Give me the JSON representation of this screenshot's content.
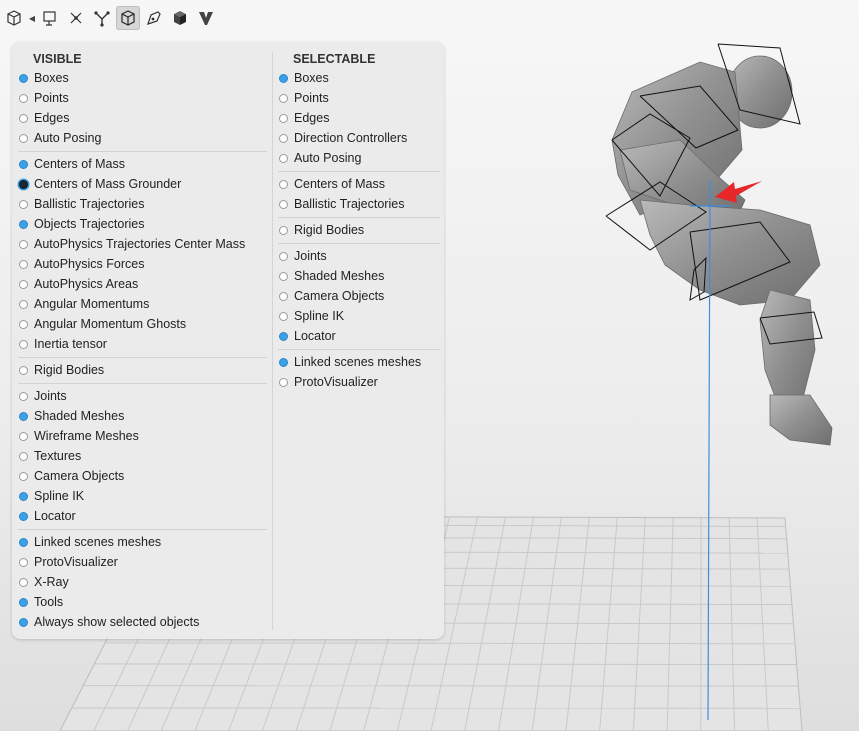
{
  "toolbar": {
    "icons": [
      "cube-outline-icon",
      "triangle-left-icon",
      "frame-icon",
      "joints-graph-icon",
      "bone-icon",
      "box-wireframe-icon",
      "pen-tool-icon",
      "solid-cube-icon",
      "v-shape-icon"
    ]
  },
  "visible": {
    "title": "VISIBLE",
    "groups": [
      [
        {
          "label": "Boxes",
          "state": "on"
        },
        {
          "label": "Points",
          "state": "off"
        },
        {
          "label": "Edges",
          "state": "off"
        },
        {
          "label": "Auto Posing",
          "state": "off"
        }
      ],
      [
        {
          "label": "Centers of Mass",
          "state": "on"
        },
        {
          "label": "Centers of Mass Grounder",
          "state": "dark"
        },
        {
          "label": "Ballistic Trajectories",
          "state": "off"
        },
        {
          "label": "Objects Trajectories",
          "state": "on"
        },
        {
          "label": "AutoPhysics Trajectories Center Mass",
          "state": "off"
        },
        {
          "label": "AutoPhysics Forces",
          "state": "off"
        },
        {
          "label": "AutoPhysics Areas",
          "state": "off"
        },
        {
          "label": "Angular Momentums",
          "state": "off"
        },
        {
          "label": "Angular Momentum Ghosts",
          "state": "off"
        },
        {
          "label": "Inertia tensor",
          "state": "off"
        }
      ],
      [
        {
          "label": "Rigid Bodies",
          "state": "off"
        }
      ],
      [
        {
          "label": "Joints",
          "state": "off"
        },
        {
          "label": "Shaded Meshes",
          "state": "on"
        },
        {
          "label": "Wireframe Meshes",
          "state": "off"
        },
        {
          "label": "Textures",
          "state": "off"
        },
        {
          "label": "Camera Objects",
          "state": "off"
        },
        {
          "label": "Spline IK",
          "state": "on"
        },
        {
          "label": "Locator",
          "state": "on"
        }
      ],
      [
        {
          "label": "Linked scenes meshes",
          "state": "on"
        },
        {
          "label": "ProtoVisualizer",
          "state": "off"
        },
        {
          "label": "X-Ray",
          "state": "off"
        },
        {
          "label": "Tools",
          "state": "on"
        },
        {
          "label": "Always show selected objects",
          "state": "on"
        }
      ]
    ]
  },
  "selectable": {
    "title": "SELECTABLE",
    "groups": [
      [
        {
          "label": "Boxes",
          "state": "on"
        },
        {
          "label": "Points",
          "state": "off"
        },
        {
          "label": "Edges",
          "state": "off"
        },
        {
          "label": "Direction Controllers",
          "state": "off"
        },
        {
          "label": "Auto Posing",
          "state": "off"
        }
      ],
      [
        {
          "label": "Centers of Mass",
          "state": "off"
        },
        {
          "label": "Ballistic Trajectories",
          "state": "off"
        }
      ],
      [
        {
          "label": "Rigid Bodies",
          "state": "off"
        }
      ],
      [
        {
          "label": "Joints",
          "state": "off"
        },
        {
          "label": "Shaded Meshes",
          "state": "off"
        },
        {
          "label": "Camera Objects",
          "state": "off"
        },
        {
          "label": "Spline IK",
          "state": "off"
        },
        {
          "label": "Locator",
          "state": "on"
        }
      ],
      [
        {
          "label": "Linked scenes meshes",
          "state": "on"
        },
        {
          "label": "ProtoVisualizer",
          "state": "off"
        }
      ]
    ]
  },
  "colors": {
    "radio_on": "#3aa0e8",
    "annotation_arrow": "#e8272b",
    "trajectory_line": "#3a8fe0",
    "panel_bg": "#ebebeb",
    "viewport_bg": "#ececec"
  }
}
